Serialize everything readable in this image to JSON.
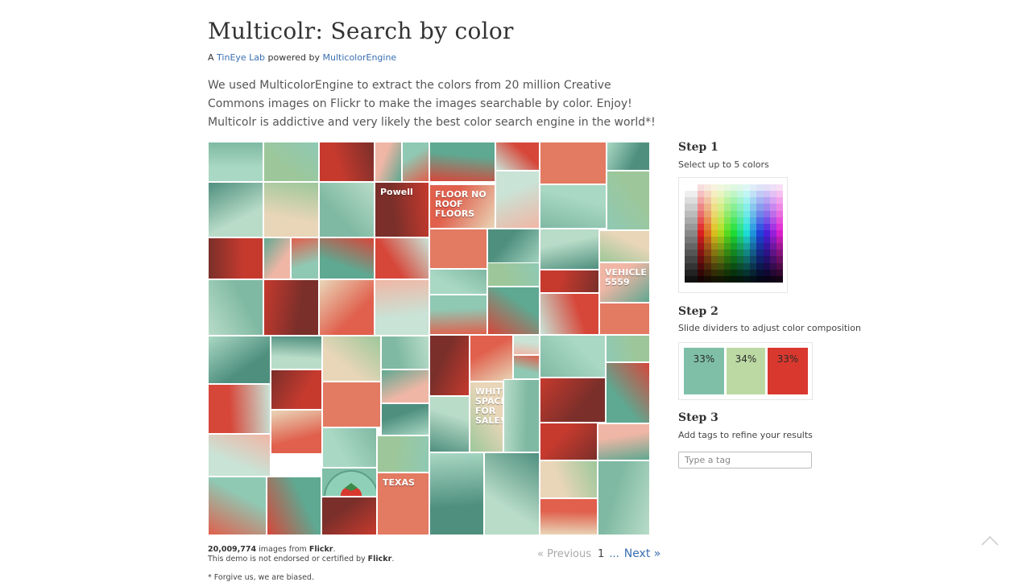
{
  "header": {
    "title": "Multicolr: Search by color",
    "byline_prefix": "A ",
    "tineye_link": "TinEye Lab",
    "byline_mid": " powered by ",
    "engine_link": "MulticolorEngine"
  },
  "intro": "We used MulticolorEngine to extract the colors from 20 million Creative Commons images on Flickr to make the images searchable by color. Enjoy! Multicolr is addictive and very likely the best color search engine in the world*!",
  "mosaic": {
    "tile_texts": [
      "Powell",
      "FLOOR NO ROOF FLOORS",
      "VEHICLE 5559",
      "WHITE SPACE FOR SALE!",
      "TEXAS"
    ]
  },
  "footer": {
    "count": "20,009,774",
    "count_suffix": " images from ",
    "flickr": "Flickr",
    "period": ".",
    "disclaimer_prefix": "This demo is not endorsed or certified by ",
    "disclaimer_flickr": "Flickr",
    "disclaimer_period": ".",
    "forgive": "* Forgive us, we are biased."
  },
  "pager": {
    "previous": "« Previous",
    "current": "1",
    "ellipsis": "...",
    "next": "Next »"
  },
  "steps": {
    "step1": {
      "title": "Step 1",
      "desc": "Select up to 5 colors"
    },
    "step2": {
      "title": "Step 2",
      "desc": "Slide dividers to adjust color composition"
    },
    "step3": {
      "title": "Step 3",
      "desc": "Add tags to refine your results"
    }
  },
  "composition": [
    {
      "percent": "33%",
      "color": "#7fbfa8"
    },
    {
      "percent": "34%",
      "color": "#bcd9a4"
    },
    {
      "percent": "33%",
      "color": "#d9382e"
    }
  ],
  "tag_input": {
    "placeholder": "Type a tag",
    "value": ""
  },
  "icons": {
    "scroll_top": "chevron-up-icon"
  },
  "colors": {
    "link": "#3a6fb0",
    "accent_red": "#d9382e",
    "mint": "#7fbfa8"
  }
}
